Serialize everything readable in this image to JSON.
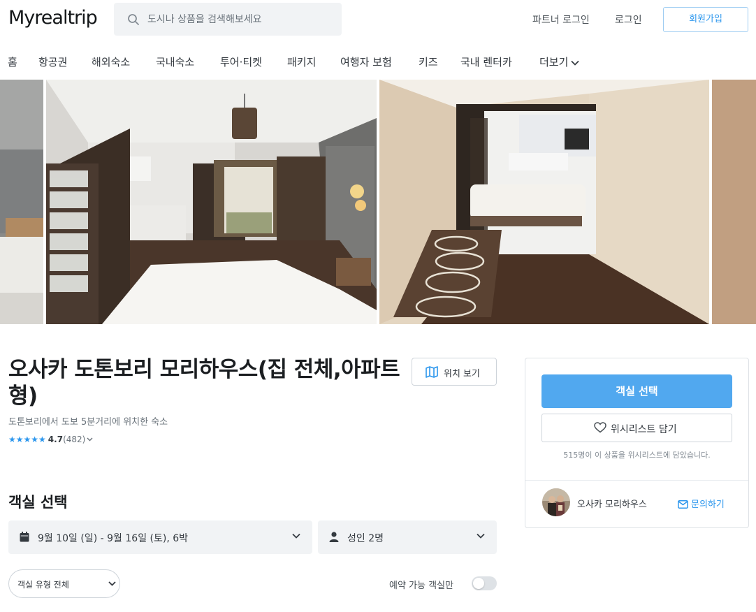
{
  "header": {
    "logo": "Myrealtrip",
    "search_placeholder": "도시나 상품을 검색해보세요",
    "partner_login": "파트너 로그인",
    "login": "로그인",
    "signup": "회원가입"
  },
  "nav": {
    "items": [
      "홈",
      "항공권",
      "해외숙소",
      "국내숙소",
      "투어·티켓",
      "패키지",
      "여행자 보험",
      "키즈",
      "국내 렌터카"
    ],
    "more": "더보기"
  },
  "product": {
    "title": "오사카 도톤보리 모리하우스(집 전체,아파트형)",
    "map_button": "위치 보기",
    "subtitle": "도톤보리에서 도보 5분거리에 위치한 숙소",
    "rating": "4.7",
    "review_count": "(482)"
  },
  "room_select": {
    "heading": "객실 선택",
    "dates": "9월 10일 (일) - 9월 16일 (토), 6박",
    "guests": "성인 2명",
    "room_type": "객실 유형 전체",
    "available_only_label": "예약 가능 객실만",
    "available_only": false
  },
  "card": {
    "select_room": "객실 선택",
    "wishlist": "위시리스트 담기",
    "wishlist_note": "515명이 이 상품을 위시리스트에 담았습니다.",
    "host_name": "오사카 모리하우스",
    "inquiry": "문의하기"
  },
  "colors": {
    "accent": "#2b96ed",
    "cta": "#51a8ef"
  }
}
